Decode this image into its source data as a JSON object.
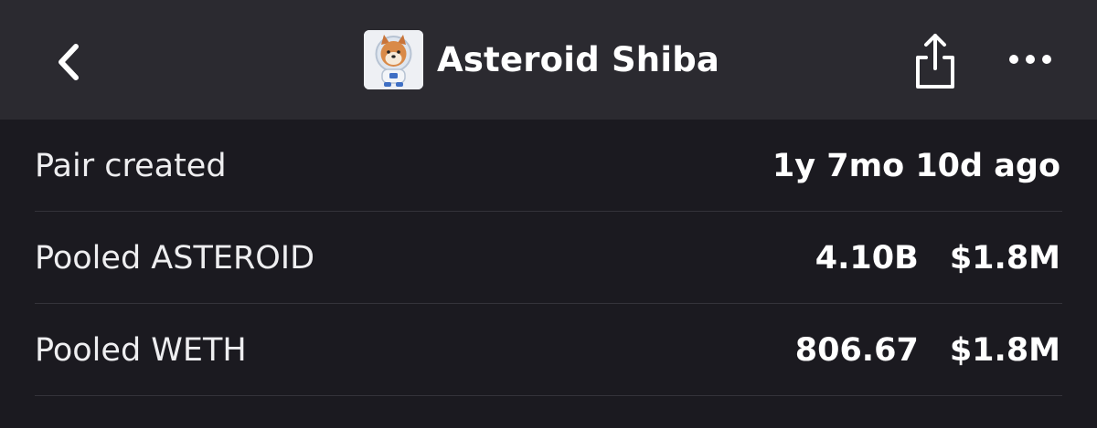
{
  "header": {
    "title": "Asteroid Shiba",
    "back_icon": "chevron-left-icon",
    "share_icon": "share-icon",
    "more_icon": "more-horizontal-icon",
    "token_logo": "shiba-astronaut-logo"
  },
  "info": {
    "pair_created": {
      "label": "Pair created",
      "value": "1y 7mo 10d ago"
    },
    "pooled_token": {
      "label": "Pooled ASTEROID",
      "amount": "4.10B",
      "usd": "$1.8M"
    },
    "pooled_weth": {
      "label": "Pooled WETH",
      "amount": "806.67",
      "usd": "$1.8M"
    }
  },
  "colors": {
    "header_bg": "#2b2a30",
    "page_bg": "#1b1a20",
    "divider": "#34333a",
    "text": "#ffffff"
  }
}
